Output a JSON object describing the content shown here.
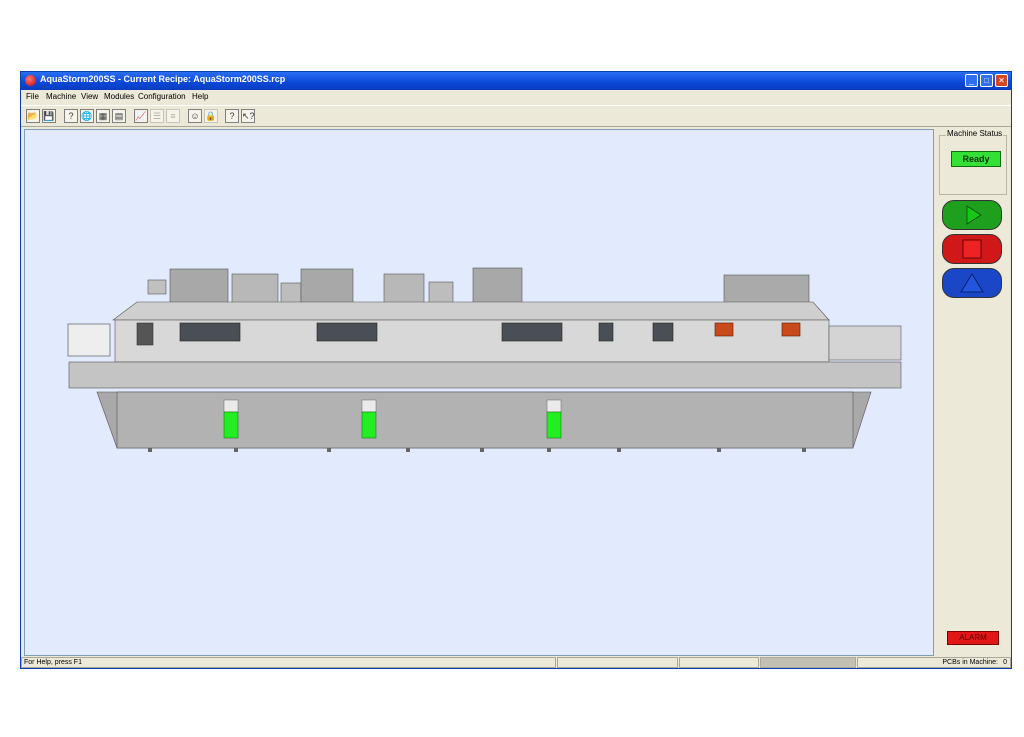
{
  "window": {
    "title": "AquaStorm200SS - Current Recipe: AquaStorm200SS.rcp"
  },
  "menu": [
    "File",
    "Machine",
    "View",
    "Modules",
    "Configuration",
    "Help"
  ],
  "toolbar": {
    "open_icon": "📂",
    "save_icon": "💾",
    "help_icon": "?",
    "globe_icon": "🌐",
    "grid_icon": "▦",
    "calc_icon": "▤",
    "chart_icon": "📈",
    "list_icon": "☰",
    "list2_icon": "≡",
    "user_icon": "☺",
    "lock_icon": "🔒",
    "about_icon": "?",
    "context_help_icon": "↖?"
  },
  "side_panel": {
    "status_label": "Machine Status",
    "status_value": "Ready",
    "alarm_label": "ALARM",
    "colors": {
      "ready": "#34e034",
      "start": "#1ea01e",
      "stop": "#d01818",
      "eject": "#1a46c8"
    }
  },
  "statusbar": {
    "help_text": "For Help, press F1",
    "pcbs_label": "PCBs in Machine:",
    "pcbs_count": "0"
  }
}
